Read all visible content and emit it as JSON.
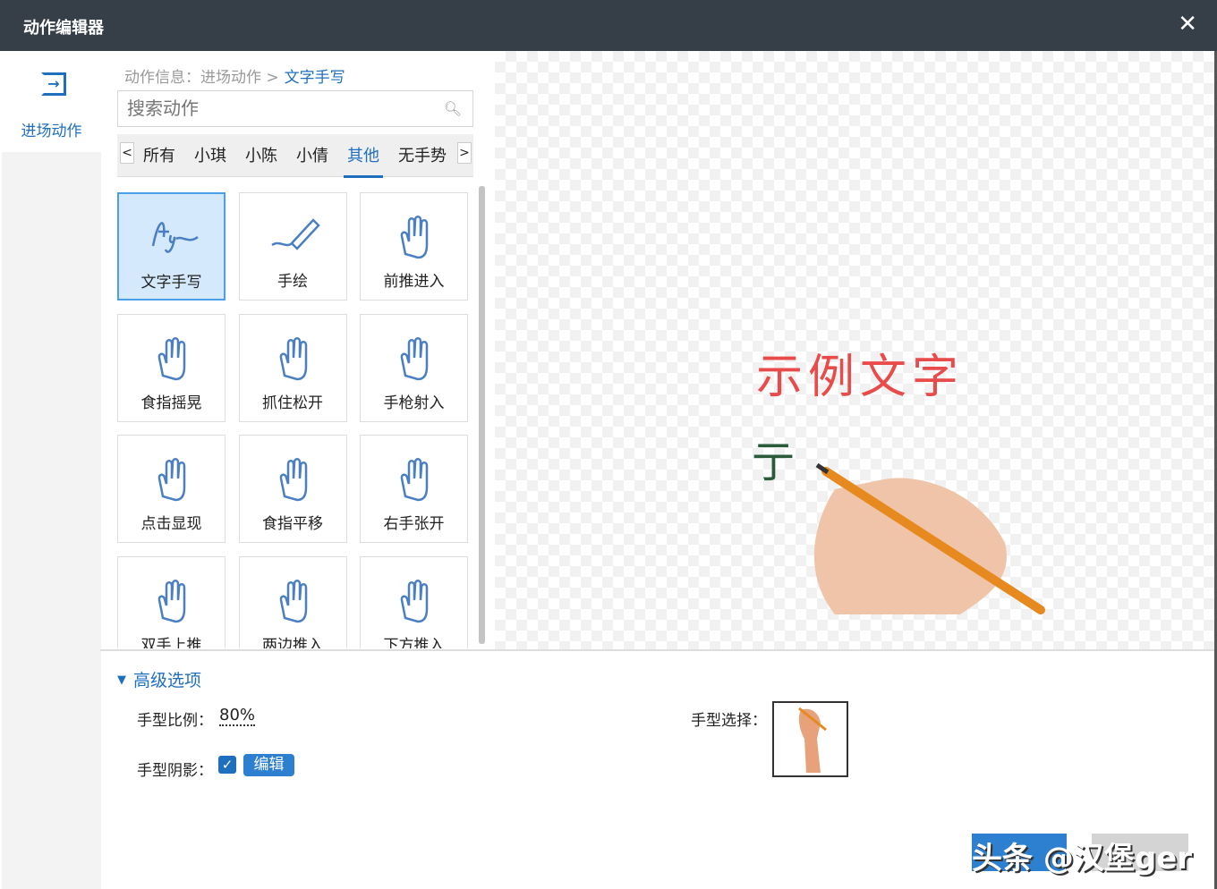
{
  "window": {
    "title": "动作编辑器",
    "close": "✕"
  },
  "sidebar": {
    "item": "进场动作",
    "icon": "enter-icon"
  },
  "breadcrumb": {
    "prefix": "动作信息：进场动作 >",
    "current": "文字手写"
  },
  "search": {
    "placeholder": "搜索动作",
    "value": ""
  },
  "tabs": [
    "所有",
    "小琪",
    "小陈",
    "小倩",
    "其他",
    "无手势"
  ],
  "active_tab": "其他",
  "actions": [
    {
      "label": "文字手写",
      "icon": "handwriting-icon",
      "selected": true
    },
    {
      "label": "手绘",
      "icon": "pen-icon"
    },
    {
      "label": "前推进入",
      "icon": "hand-push-icon"
    },
    {
      "label": "食指摇晃",
      "icon": "finger-shake-icon"
    },
    {
      "label": "抓住松开",
      "icon": "grab-icon"
    },
    {
      "label": "手枪射入",
      "icon": "finger-gun-icon"
    },
    {
      "label": "点击显现",
      "icon": "tap-icon"
    },
    {
      "label": "食指平移",
      "icon": "finger-move-icon"
    },
    {
      "label": "右手张开",
      "icon": "open-hand-icon"
    },
    {
      "label": "双手上推",
      "icon": "two-hands-icon"
    },
    {
      "label": "两边推入",
      "icon": "side-push-icon"
    },
    {
      "label": "下方推入",
      "icon": "bottom-push-icon"
    }
  ],
  "preview": {
    "sample_text": "示例文字",
    "partial_char": "亍"
  },
  "advanced": {
    "title": "高级选项",
    "scale_label": "手型比例：",
    "scale_value": "80%",
    "shadow_label": "手型阴影：",
    "shadow_checked": true,
    "edit_label": "编辑",
    "hand_label": "手型选择："
  },
  "watermark": "头条 @汉堡ger",
  "colors": {
    "accent": "#1f6fbf",
    "titlebar": "#363e48",
    "sample": "#e94b4b"
  }
}
